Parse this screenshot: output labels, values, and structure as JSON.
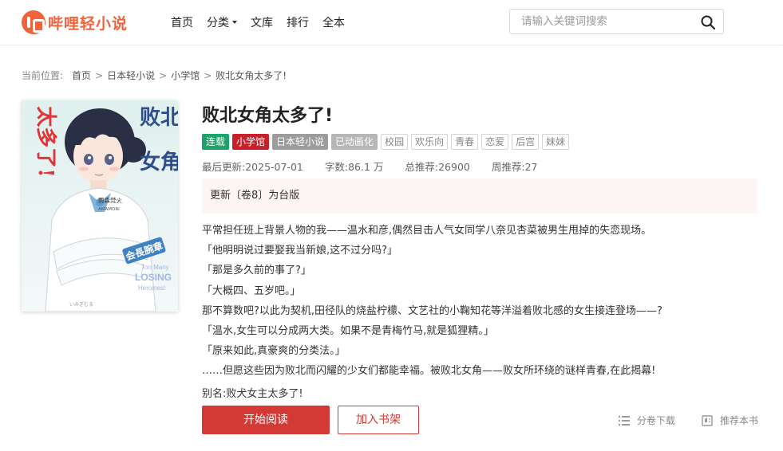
{
  "site": {
    "logo_text": "哔哩轻小说",
    "brand_color": "#f0643c"
  },
  "nav": [
    {
      "label": "首页"
    },
    {
      "label": "分类",
      "has_dropdown": true
    },
    {
      "label": "文库"
    },
    {
      "label": "排行"
    },
    {
      "label": "全本"
    }
  ],
  "search": {
    "placeholder": "请输入关键词搜索",
    "value": "",
    "icon": "search-icon"
  },
  "breadcrumb": {
    "prefix": "当前位置:",
    "items": [
      "首页",
      "日本轻小说",
      "小学馆",
      "败北女角太多了!"
    ],
    "separator": ">"
  },
  "book": {
    "title": "败北女角太多了!",
    "cover": {
      "title_lines": [
        "败北",
        "女角",
        "太多了!"
      ],
      "author_jp": "雨森焚火",
      "author_en": "AMAMORI",
      "illustrator": "いみぎむる",
      "en_title_lines": [
        "Too Many",
        "LOSING",
        "Heroines!"
      ],
      "armband": "会長腕章"
    },
    "tags": [
      {
        "label": "连载",
        "style": "solid",
        "color": "#1aa46a"
      },
      {
        "label": "小学馆",
        "style": "solid",
        "color": "#c8202a"
      },
      {
        "label": "日本轻小说",
        "style": "solid",
        "color": "#9c9c9c"
      },
      {
        "label": "已动画化",
        "style": "solid",
        "color": "#b6b6b6"
      },
      {
        "label": "校园",
        "style": "outline"
      },
      {
        "label": "欢乐向",
        "style": "outline"
      },
      {
        "label": "青春",
        "style": "outline"
      },
      {
        "label": "恋爱",
        "style": "outline"
      },
      {
        "label": "后宫",
        "style": "outline"
      },
      {
        "label": "妹妹",
        "style": "outline"
      }
    ],
    "meta": {
      "last_update": "最后更新:2025-07-01",
      "word_count": "字数:86.1 万",
      "total_recommend": "总推荐:26900",
      "weekly_recommend": "周推荐:27"
    },
    "latest_update": "更新〔卷8〕为台版",
    "description": [
      "平常担任班上背景人物的我——温水和彦,偶然目击人气女同学八奈见杏菜被男生甩掉的失恋现场。",
      "「他明明说过要娶我当新娘,这不过分吗?」",
      "「那是多久前的事了?」",
      "「大概四、五岁吧。」",
      "那不算数吧?以此为契机,田径队的烧盐柠檬、文艺社的小鞠知花等洋溢着败北感的女生接连登场——?",
      "「温水,女生可以分成两大类。如果不是青梅竹马,就是狐狸精。」",
      "「原来如此,真豪爽的分类法。」",
      "……但愿这些因为败北而闪耀的少女们都能幸福。被败北女角——败女所环绕的谜样青春,在此揭幕!"
    ],
    "alias": "别名:败犬女主太多了!"
  },
  "actions": {
    "read_button": "开始阅读",
    "shelf_button": "加入书架",
    "download": {
      "label": "分卷下载",
      "icon": "list-icon"
    },
    "recommend": {
      "label": "推荐本书",
      "icon": "recommend-icon"
    }
  },
  "colors": {
    "accent": "#d33a36",
    "update_bg": "#fdf4f4"
  }
}
